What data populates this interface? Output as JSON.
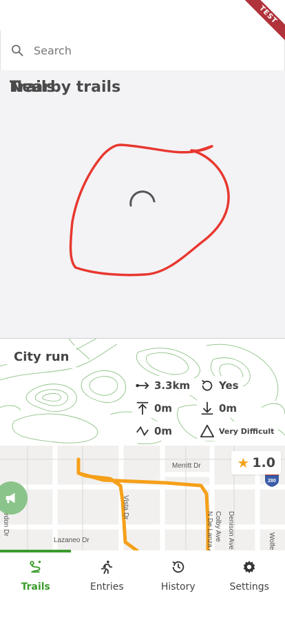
{
  "ribbon": {
    "label": "TEST"
  },
  "search": {
    "placeholder": "Search"
  },
  "nearby": {
    "title": "Nearby trails"
  },
  "trails": {
    "title": "Trails",
    "card": {
      "name": "City run",
      "distance": "3.3km",
      "loop": "Yes",
      "ascent": "0m",
      "descent": "0m",
      "elevation_change": "0m",
      "difficulty": "Very Difficult",
      "rating": "1.0",
      "map_labels": {
        "street1": "Lazaneo Dr",
        "street2": "Colby Ave",
        "street3": "Denison Ave",
        "street4": "Merritt Dr",
        "street5": "Vista Dr",
        "street6": "Wolfe Rd",
        "street7": "Reardon Dr",
        "street8": "N De Lanza Ave",
        "highway": "280"
      }
    }
  },
  "nav": {
    "items": [
      {
        "label": "Trails",
        "icon": "route-icon",
        "active": true
      },
      {
        "label": "Entries",
        "icon": "runner-icon",
        "active": false
      },
      {
        "label": "History",
        "icon": "history-icon",
        "active": false
      },
      {
        "label": "Settings",
        "icon": "gear-icon",
        "active": false
      }
    ]
  },
  "colors": {
    "accent": "#3a9b2c",
    "route": "#f5a01a",
    "annotation": "#e8382f",
    "star": "#f2a21a"
  }
}
